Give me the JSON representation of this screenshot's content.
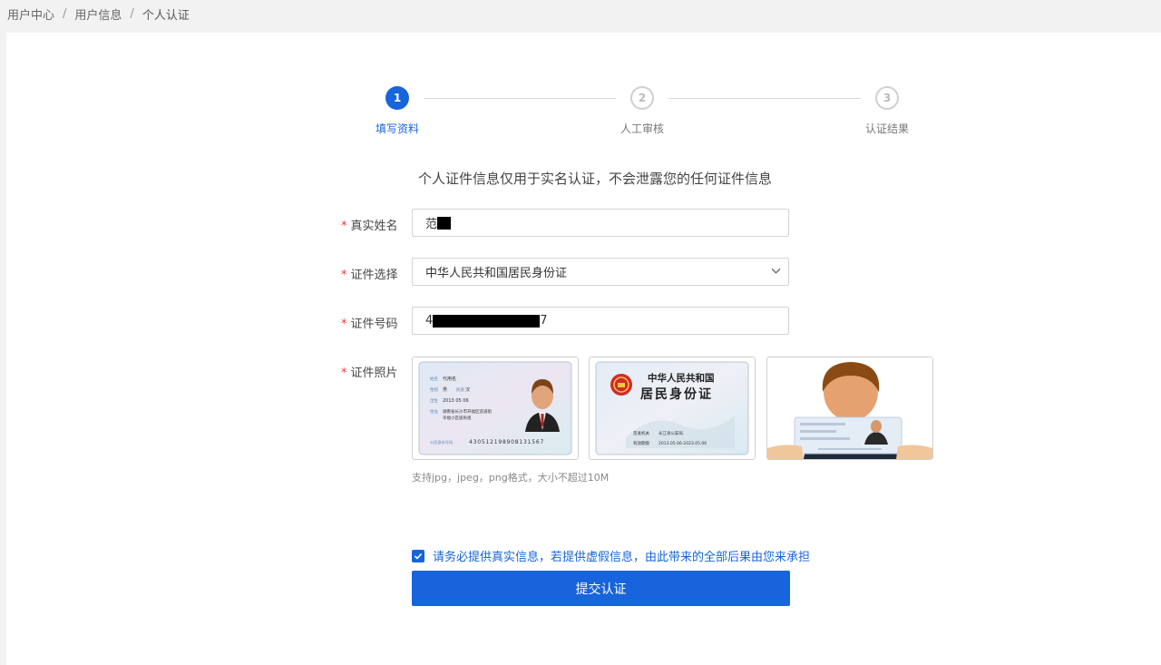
{
  "breadcrumb": {
    "items": [
      "用户中心",
      "用户信息"
    ],
    "current": "个人认证",
    "separator": "/"
  },
  "steps": [
    {
      "number": "1",
      "label": "填写资料",
      "state": "active"
    },
    {
      "number": "2",
      "label": "人工审核",
      "state": "pending"
    },
    {
      "number": "3",
      "label": "认证结果",
      "state": "pending"
    }
  ],
  "notice": "个人证件信息仅用于实名认证，不会泄露您的任何证件信息",
  "form": {
    "name": {
      "label": "真实姓名",
      "value_prefix": "范"
    },
    "id_type": {
      "label": "证件选择",
      "value": "中华人民共和国居民身份证"
    },
    "id_number": {
      "label": "证件号码",
      "value_prefix": "4",
      "value_suffix": "7"
    },
    "photos": {
      "label": "证件照片",
      "front": {
        "name_field": "代用名",
        "gender": "男",
        "ethnicity": "汉",
        "birth": "2013 05 06",
        "address_1": "湖南省长沙市开福区巡道街",
        "address_2": "幸福小区居民组",
        "number_label": "公民身份号码",
        "number": "430512198908131567",
        "row_labels": [
          "姓名",
          "性别",
          "民族",
          "出生",
          "住址"
        ]
      },
      "back": {
        "country": "中华人民共和国",
        "title": "居民身份证",
        "authority_label": "签发机关",
        "authority": "长江县公安局",
        "validity_label": "有效期限",
        "validity": "2013.05.06-2023.05.06"
      }
    },
    "hint": "支持jpg，jpeg，png格式，大小不超过10M"
  },
  "agreement": {
    "text": "请务必提供真实信息，若提供虚假信息，由此带来的全部后果由您来承担",
    "checked": true
  },
  "submit_label": "提交认证",
  "colors": {
    "primary": "#1764dc",
    "required": "#e53935"
  }
}
